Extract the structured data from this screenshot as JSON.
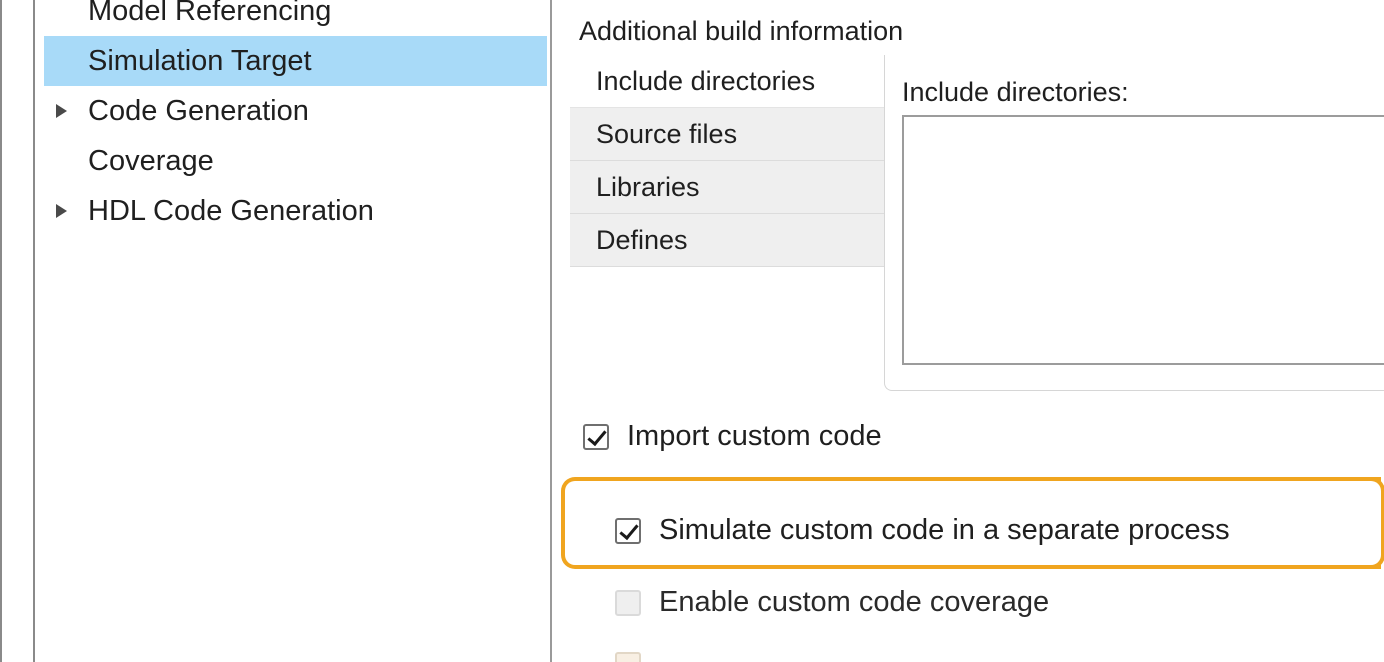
{
  "tree": {
    "items": [
      {
        "label": "Model Referencing",
        "expandable": false,
        "selected": false
      },
      {
        "label": "Simulation Target",
        "expandable": false,
        "selected": true
      },
      {
        "label": "Code Generation",
        "expandable": true,
        "selected": false
      },
      {
        "label": "Coverage",
        "expandable": false,
        "selected": false
      },
      {
        "label": "HDL Code Generation",
        "expandable": true,
        "selected": false
      }
    ]
  },
  "main": {
    "section_title": "Additional build information",
    "tabs": [
      {
        "label": "Include directories",
        "active": true
      },
      {
        "label": "Source files",
        "active": false
      },
      {
        "label": "Libraries",
        "active": false
      },
      {
        "label": "Defines",
        "active": false
      }
    ],
    "panel_label": "Include directories:",
    "panel_value": "",
    "checkboxes": {
      "import_custom_code": {
        "label": "Import custom code",
        "checked": true
      },
      "simulate_separate_process": {
        "label": "Simulate custom code in a separate process",
        "checked": true
      },
      "enable_custom_code_coverage": {
        "label": "Enable custom code coverage",
        "checked": false
      }
    },
    "highlight_color": "#f0a51f"
  },
  "colors": {
    "selected_bg": "#a8daf8",
    "tab_bg": "#efefef",
    "highlight": "#f0a51f"
  }
}
